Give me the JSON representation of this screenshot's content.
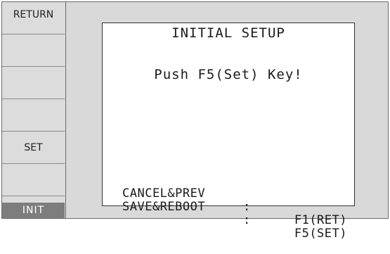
{
  "function_keys": [
    {
      "label": "RETURN"
    },
    {
      "label": ""
    },
    {
      "label": ""
    },
    {
      "label": ""
    },
    {
      "label": "SET"
    },
    {
      "label": ""
    }
  ],
  "mode_tab": "INIT",
  "dialog": {
    "title": "INITIAL SETUP",
    "message": "Push F5(Set) Key!",
    "options": [
      {
        "action": "CANCEL&PREV",
        "separator": ":",
        "key": "F1(RET)"
      },
      {
        "action": "SAVE&REBOOT",
        "separator": ":",
        "key": "F5(SET)"
      }
    ]
  }
}
